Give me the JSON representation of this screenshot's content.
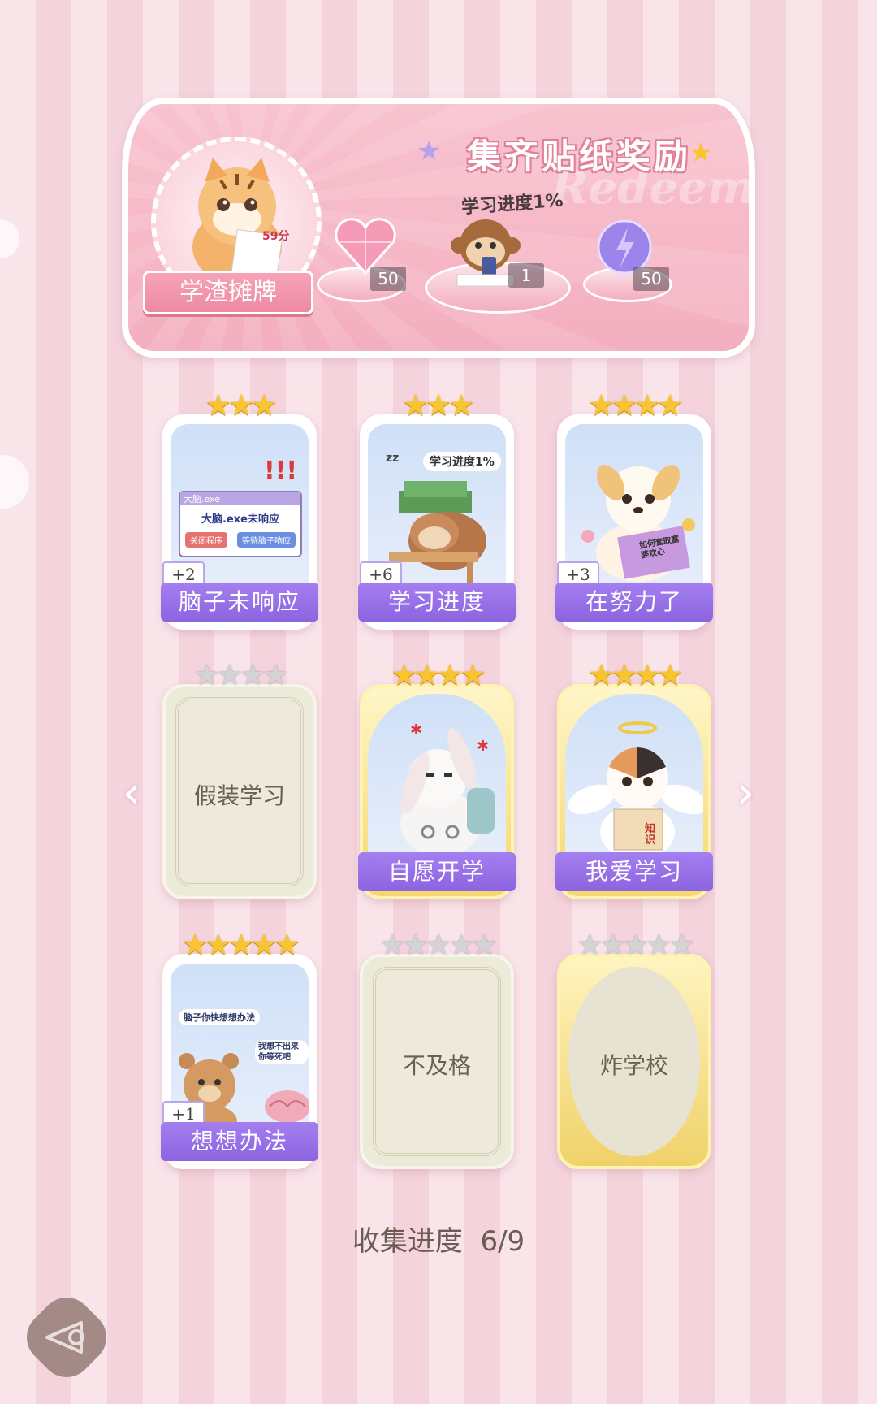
{
  "banner": {
    "title": "集齐贴纸奖励",
    "watermark": "Redeem",
    "avatar_title": "学渣摊牌",
    "avatar_score": "59分",
    "progress_tag": "学习进度1%",
    "rewards": [
      {
        "icon": "pink-heart-gem-icon",
        "count": "50"
      },
      {
        "icon": "monkey-studying-icon",
        "count": "1"
      },
      {
        "icon": "purple-lightning-orb-icon",
        "count": "50"
      }
    ]
  },
  "cards": [
    {
      "label": "脑子未响应",
      "stars_total": 3,
      "stars_on": 3,
      "plus": "+2",
      "state": "collected",
      "art": {
        "window_title": "大脑.exe",
        "message": "大脑.exe未响应",
        "btn1": "关闭程序",
        "btn2": "等待脑子响应",
        "exclaim": "!!!"
      }
    },
    {
      "label": "学习进度",
      "stars_total": 3,
      "stars_on": 3,
      "plus": "+6",
      "state": "collected",
      "art": {
        "bubble": "学习进度1%",
        "zz": "zz"
      }
    },
    {
      "label": "在努力了",
      "stars_total": 4,
      "stars_on": 4,
      "plus": "+3",
      "state": "collected",
      "art": {
        "book": "如何套取富婆欢心"
      }
    },
    {
      "label": "假装学习",
      "stars_total": 4,
      "stars_on": 0,
      "plus": "",
      "state": "locked"
    },
    {
      "label": "自愿开学",
      "stars_total": 4,
      "stars_on": 4,
      "plus": "",
      "state": "collected-gold"
    },
    {
      "label": "我爱学习",
      "stars_total": 4,
      "stars_on": 4,
      "plus": "",
      "state": "collected-gold",
      "art": {
        "book": "知识"
      }
    },
    {
      "label": "想想办法",
      "stars_total": 5,
      "stars_on": 5,
      "plus": "+1",
      "state": "collected",
      "art": {
        "bubble1": "脑子你快想想办法",
        "bubble2": "我想不出来你等死吧"
      }
    },
    {
      "label": "不及格",
      "stars_total": 5,
      "stars_on": 0,
      "plus": "",
      "state": "locked"
    },
    {
      "label": "炸学校",
      "stars_total": 5,
      "stars_on": 0,
      "plus": "",
      "state": "locked-gold"
    }
  ],
  "collect_progress": "收集进度  6/9",
  "colors": {
    "label_purple": "#8c64e0",
    "star_gold": "#f7c531",
    "banner_pink": "#f6b7c6"
  }
}
